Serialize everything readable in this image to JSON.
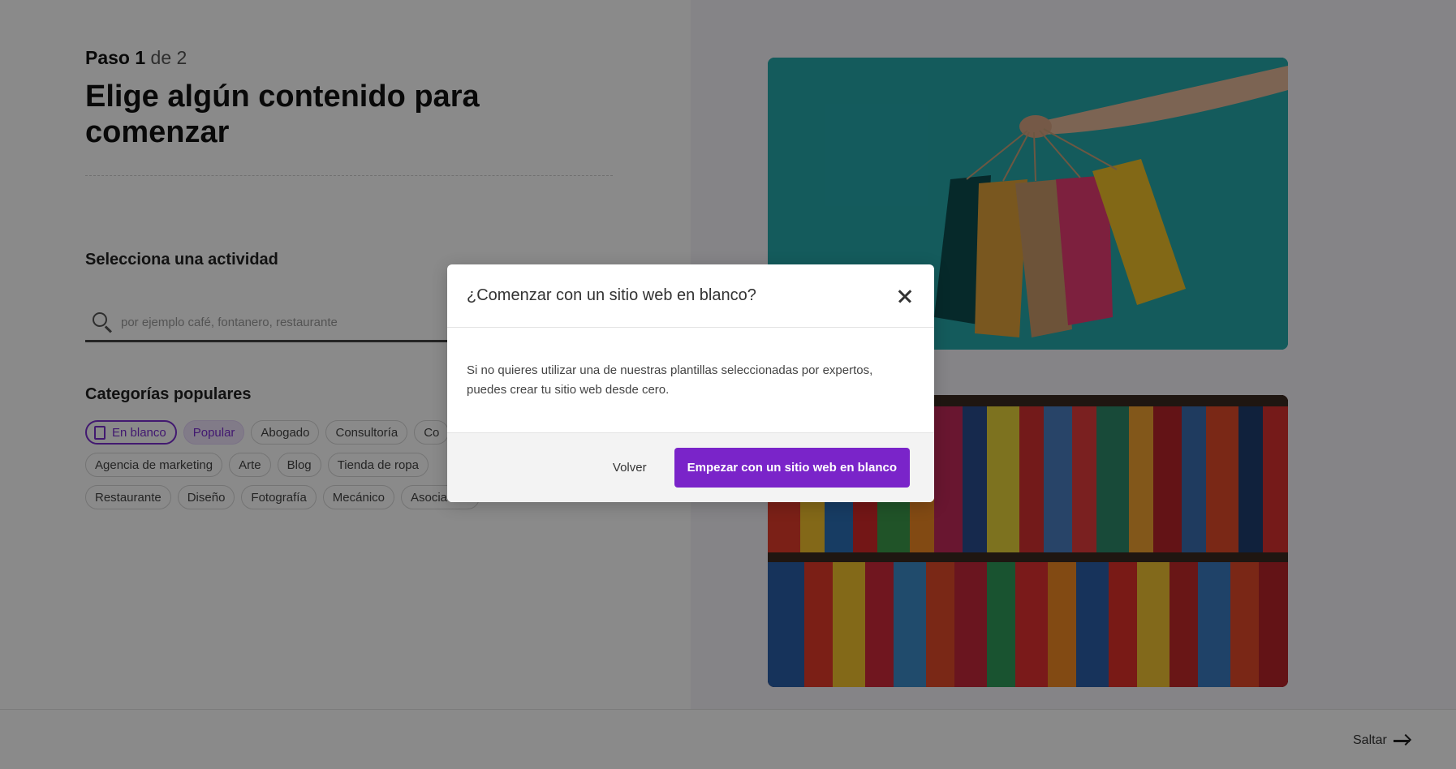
{
  "header": {
    "step_current": "Paso 1",
    "step_total": "de 2",
    "title": "Elige algún contenido para comenzar"
  },
  "activity": {
    "label": "Selecciona una actividad",
    "search_placeholder": "por ejemplo café, fontanero, restaurante"
  },
  "categories": {
    "label": "Categorías populares",
    "row1": [
      "En blanco",
      "Popular",
      "Abogado",
      "Consultoría",
      "Co"
    ],
    "row2": [
      "Agencia de marketing",
      "Arte",
      "Blog",
      "Tienda de ropa"
    ],
    "row3": [
      "Restaurante",
      "Diseño",
      "Fotografía",
      "Mecánico",
      "Asociación"
    ]
  },
  "images": {
    "top": "shopping-bags-image",
    "bottom": "clothes-rack-image"
  },
  "footer": {
    "skip_label": "Saltar"
  },
  "modal": {
    "title": "¿Comenzar con un sitio web en blanco?",
    "body": "Si no quieres utilizar una de nuestras plantillas seleccionadas por expertos, puedes crear tu sitio web desde cero.",
    "back_label": "Volver",
    "start_label": "Empezar con un sitio web en blanco"
  },
  "colors": {
    "accent": "#7a24c9",
    "overlay": "rgba(0,0,0,0.46)"
  }
}
